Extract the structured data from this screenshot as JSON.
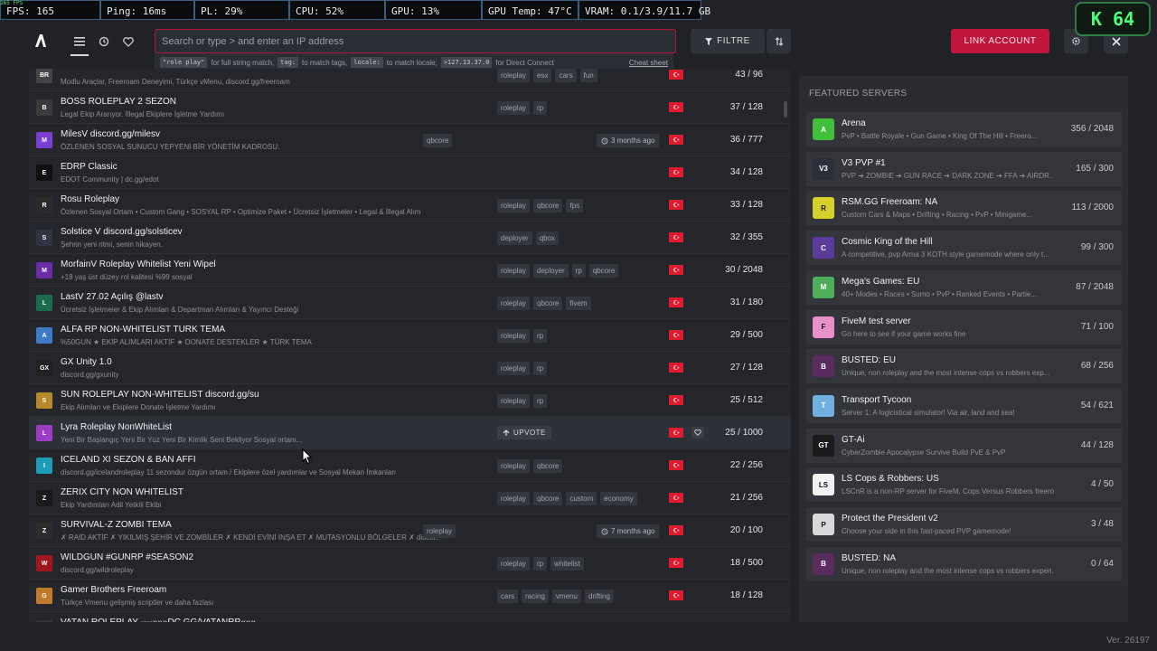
{
  "overlay": {
    "mini": "165 FPS",
    "stats": [
      "FPS: 165",
      "Ping: 16ms",
      "PL: 29%",
      "CPU: 52%",
      "GPU: 13%",
      "GPU Temp: 47°C",
      "VRAM: 0.1/3.9/11.7 GB"
    ],
    "badge_letter": "K",
    "badge_value": "64"
  },
  "topbar": {
    "search_placeholder": "Search or type > and enter an IP address",
    "hints": {
      "h1_code": "\"role play\"",
      "h1_text": "for full string match,",
      "h2_code": "tag:",
      "h2_text": "to match tags,",
      "h3_code": "locale:",
      "h3_text": "to match locale,",
      "h4_code": ">127.13.37.0",
      "h4_text": "for Direct Connect",
      "cheat": "Cheat sheet"
    },
    "filter_label": "FILTRE",
    "link_label": "LINK ACCOUNT"
  },
  "servers": [
    {
      "name": "",
      "desc": "Modlu Araçlar, Freeroam Deneyimi, Türkçe vMenu, discord.gg/freeroam",
      "tags": [
        "roleplay",
        "esx",
        "cars",
        "fun"
      ],
      "players": "43 / 96",
      "icon": "BR",
      "color": "#444"
    },
    {
      "name": "BOSS ROLEPLAY 2 SEZON",
      "desc": "Legal Ekip Ararıyor. İllegal Ekiplere İşletme Yardımı",
      "tags": [
        "roleplay",
        "rp"
      ],
      "players": "37 / 128",
      "icon": "B",
      "color": "#3a3a3a"
    },
    {
      "name": "MilesV discord.gg/milesv",
      "desc": "ÖZLENEN SOSYAL SUNUCU YEPYENİ BİR YÖNETİM KADROSU.",
      "tags": [
        "qbcore"
      ],
      "ago": "3 months ago",
      "players": "36 / 777",
      "icon": "M",
      "color": "#7a3fd1"
    },
    {
      "name": "EDRP Classic",
      "desc": "EDOT Community | dc.gg/edot",
      "tags": [],
      "players": "34 / 128",
      "icon": "E",
      "color": "#111"
    },
    {
      "name": "Rosu Roleplay",
      "desc": "Özlenen Sosyal Ortam • Custom Gang • SOSYAL RP • Optimize Paket • Ücretsiz İşletmeler • Legal & İllegal Alım",
      "tags": [
        "roleplay",
        "qbcore",
        "fps"
      ],
      "players": "33 / 128",
      "icon": "R",
      "color": "#2b2b2b"
    },
    {
      "name": "Solstice V discord.gg/solsticev",
      "desc": "Şehrin yeni ritmi, senin hikayen.",
      "tags": [
        "deployer",
        "qbox"
      ],
      "players": "32 / 355",
      "icon": "S",
      "color": "#2f3440"
    },
    {
      "name": "MorfainV Roleplay Whitelist Yeni Wipel",
      "desc": "+18 yaş üst düzey rol kalitesi %99 sosyal",
      "tags": [
        "roleplay",
        "deployer",
        "rp",
        "qbcore"
      ],
      "players": "30 / 2048",
      "icon": "M",
      "color": "#6b2ca8"
    },
    {
      "name": "LastV 27.02 Açılış @lastv",
      "desc": "Ücretsiz İşletmeler & Ekip Alımları & Departman Alımları & Yayıncı Desteği",
      "tags": [
        "roleplay",
        "qbcore",
        "fivem"
      ],
      "players": "31 / 180",
      "icon": "L",
      "color": "#1d6b4f"
    },
    {
      "name": "ALFA RP NON-WHITELIST TURK TEMA",
      "desc": "%50GUN ★ EKİP ALIMLARI AKTİF ★ DONATE DESTEKLER ★ TÜRK TEMA",
      "tags": [
        "roleplay",
        "rp"
      ],
      "players": "29 / 500",
      "icon": "A",
      "color": "#3d7bc9"
    },
    {
      "name": "GX Unity 1.0",
      "desc": "discord.gg/gxunity",
      "tags": [
        "roleplay",
        "rp"
      ],
      "players": "27 / 128",
      "icon": "GX",
      "color": "#222"
    },
    {
      "name": "SUN ROLEPLAY NON-WHITELIST discord.gg/su",
      "desc": "Ekip Alımları ve Ekiplere Donate İşletme Yardımı",
      "tags": [
        "roleplay",
        "rp"
      ],
      "players": "25 / 512",
      "icon": "S",
      "color": "#b8892b"
    },
    {
      "name": "Lyra Roleplay NonWhiteList",
      "desc": "Yeni Bir Başlangıç Yeni Bir Yüz Yeni Bir Kimlik Seni Bekliyor Sosyal ortam...",
      "tags": [],
      "upvote": "UPVOTE",
      "players": "25 / 1000",
      "icon": "L",
      "color": "#9a3cc4",
      "hl": true
    },
    {
      "name": "ICELAND XI SEZON & BAN AFFI",
      "desc": "discord.gg/icelandroleplay 11 sezondur özgün ortam / Ekiplere özel yardımlar ve Sosyal Mekan İmkanları",
      "tags": [
        "roleplay",
        "qbcore"
      ],
      "players": "22 / 256",
      "icon": "I",
      "color": "#1e9bb8"
    },
    {
      "name": "ZERIX CITY NON WHITELIST",
      "desc": "Ekip Yardımları Adil Yetkili Ekibi",
      "tags": [
        "roleplay",
        "qbcore",
        "custom",
        "economy"
      ],
      "players": "21 / 256",
      "icon": "Z",
      "color": "#1a1a1a"
    },
    {
      "name": "SURVIVAL-Z ZOMBI TEMA",
      "desc": "✗ RAİD AKTİF ✗ YIKILMIŞ ŞEHİR VE ZOMBİLER ✗ KENDİ EVİNİ İNŞA ET ✗ MUTASYONLU BÖLGELER ✗ discor...",
      "tags": [
        "roleplay"
      ],
      "ago": "7 months ago",
      "players": "20 / 100",
      "icon": "Z",
      "color": "#2c2c2c"
    },
    {
      "name": "WILDGUN #GUNRP #SEASON2",
      "desc": "discord.gg/wildroleplay",
      "tags": [
        "roleplay",
        "rp",
        "whitelist"
      ],
      "players": "18 / 500",
      "icon": "W",
      "color": "#a0161f"
    },
    {
      "name": "Gamer Brothers Freeroam",
      "desc": "Türkçe Vmenu gelişmiş scriptler ve daha fazlası",
      "tags": [
        "cars",
        "racing",
        "vmenu",
        "drifting"
      ],
      "players": "18 / 128",
      "icon": "G",
      "color": "#c07a2a"
    },
    {
      "name": "VATAN ROLEPLAY ----»»»DC.GG/VATANRP«««",
      "desc": "",
      "tags": [],
      "players": "",
      "icon": "V",
      "color": "#333"
    }
  ],
  "featured": {
    "title": "FEATURED SERVERS",
    "items": [
      {
        "name": "Arena",
        "desc": "PvP • Battle Royale • Gun Game • King Of The Hill • Freero...",
        "players": "356 / 2048",
        "icon": "A",
        "color": "#3fbf3a"
      },
      {
        "name": "V3 PVP #1",
        "desc": "PVP ➔ ZOMBIE ➔ GUN RACE ➔ DARK ZONE ➔ FFA ➔ AIRDR...",
        "players": "165 / 300",
        "icon": "V3",
        "color": "#2b2f3a"
      },
      {
        "name": "RSM.GG Freeroam: NA",
        "desc": "Custom Cars & Maps • Drifting • Racing • PvP • Minigame...",
        "players": "113 / 2000",
        "icon": "R",
        "color": "#d6d12a"
      },
      {
        "name": "Cosmic King of the Hill",
        "desc": "A competitive, pvp Arma 3 KOTH style gamemode where only t...",
        "players": "99 / 300",
        "icon": "C",
        "color": "#5a3d9a"
      },
      {
        "name": "Mega's Games: EU",
        "desc": "40+ Modes • Races • Sumo • PvP • Ranked Events • Partie...",
        "players": "87 / 2048",
        "icon": "M",
        "color": "#4fae5a"
      },
      {
        "name": "FiveM test server",
        "desc": "Go here to see if your game works fine",
        "players": "71 / 100",
        "icon": "F",
        "color": "#e890c8"
      },
      {
        "name": "BUSTED: EU",
        "desc": "Unique, non roleplay and the most intense cops vs robbers exp...",
        "players": "68 / 256",
        "icon": "B",
        "color": "#5b2a5e"
      },
      {
        "name": "Transport Tycoon",
        "desc": "Server 1: A logicistical simulator! Via air, land and sea!",
        "players": "54 / 621",
        "icon": "T",
        "color": "#6fb0e0"
      },
      {
        "name": "GT-Ai",
        "desc": "CyberZombie Apocalypse Survive Build PvE & PvP",
        "players": "44 / 128",
        "icon": "GT",
        "color": "#1a1a1a"
      },
      {
        "name": "LS Cops & Robbers: US",
        "desc": "LSCnR is a non-RP server for FiveM, Cops Versus Robbers freero...",
        "players": "4 / 50",
        "icon": "LS",
        "color": "#f2f2f2"
      },
      {
        "name": "Protect the President v2",
        "desc": "Choose your side in this fast-paced PVP gamemode!",
        "players": "3 / 48",
        "icon": "P",
        "color": "#d9d9d9"
      },
      {
        "name": "BUSTED: NA",
        "desc": "Unique, non roleplay and the most intense cops vs robbers experi...",
        "players": "0 / 64",
        "icon": "B",
        "color": "#5b2a5e"
      }
    ]
  },
  "version": "Ver. 26197"
}
